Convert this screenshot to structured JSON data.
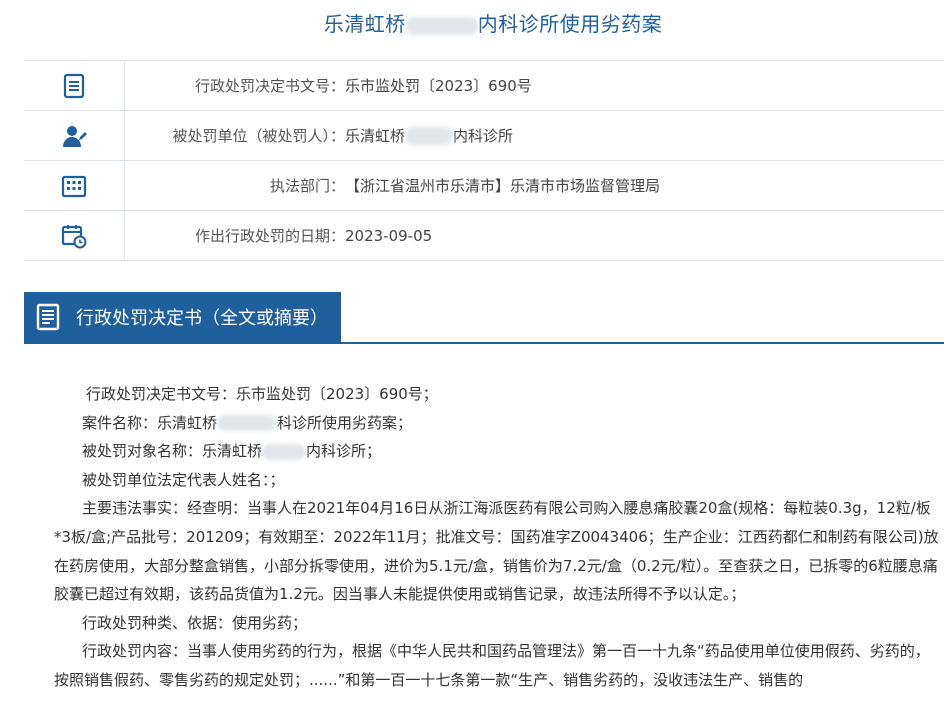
{
  "page_title": {
    "left": "乐清虹桥",
    "right": "内科诊所使用劣药案"
  },
  "info_rows": [
    {
      "icon": "document-icon",
      "label": "行政处罚决定书文号：",
      "value": "乐市监处罚〔2023〕690号"
    },
    {
      "icon": "person-icon",
      "label": "被处罚单位（被处罚人）：",
      "value_left": "乐清虹桥",
      "value_right": "内科诊所"
    },
    {
      "icon": "building-icon",
      "label": "执法部门：",
      "value": "【浙江省温州市乐清市】乐清市市场监督管理局"
    },
    {
      "icon": "calendar-clock-icon",
      "label": "作出行政处罚的日期：",
      "value": "2023-09-05"
    }
  ],
  "section": {
    "title": "行政处罚决定书（全文或摘要）"
  },
  "content": {
    "doc_no": "行政处罚决定书文号：乐市监处罚〔2023〕690号；",
    "case_name_left": "案件名称：乐清虹桥",
    "case_name_right": "科诊所使用劣药案；",
    "target_left": "被处罚对象名称：乐清虹桥",
    "target_right": "内科诊所；",
    "legal_rep": "被处罚单位法定代表人姓名：；",
    "facts": "主要违法事实：经查明：当事人在2021年04月16日从浙江海派医药有限公司购入腰息痛胶囊20盒(规格：每粒装0.3g，12粒/板*3板/盒;产品批号：201209；有效期至：2022年11月；批准文号：国药准字Z0043406；生产企业：江西药都仁和制药有限公司)放在药房使用，大部分整盒销售，小部分拆零使用，进价为5.1元/盒，销售价为7.2元/盒（0.2元/粒）。至查获之日，已拆零的6粒腰息痛胶囊已超过有效期，该药品货值为1.2元。因当事人未能提供使用或销售记录，故违法所得不予以认定。；",
    "penalty_type": "行政处罚种类、依据：使用劣药；",
    "penalty_content": "行政处罚内容：当事人使用劣药的行为，根据《中华人民共和国药品管理法》第一百一十九条“药品使用单位使用假药、劣药的，按照销售假药、零售劣药的规定处罚；......”和第一百一十七条第一款“生产、销售劣药的，没收违法生产、销售的"
  }
}
